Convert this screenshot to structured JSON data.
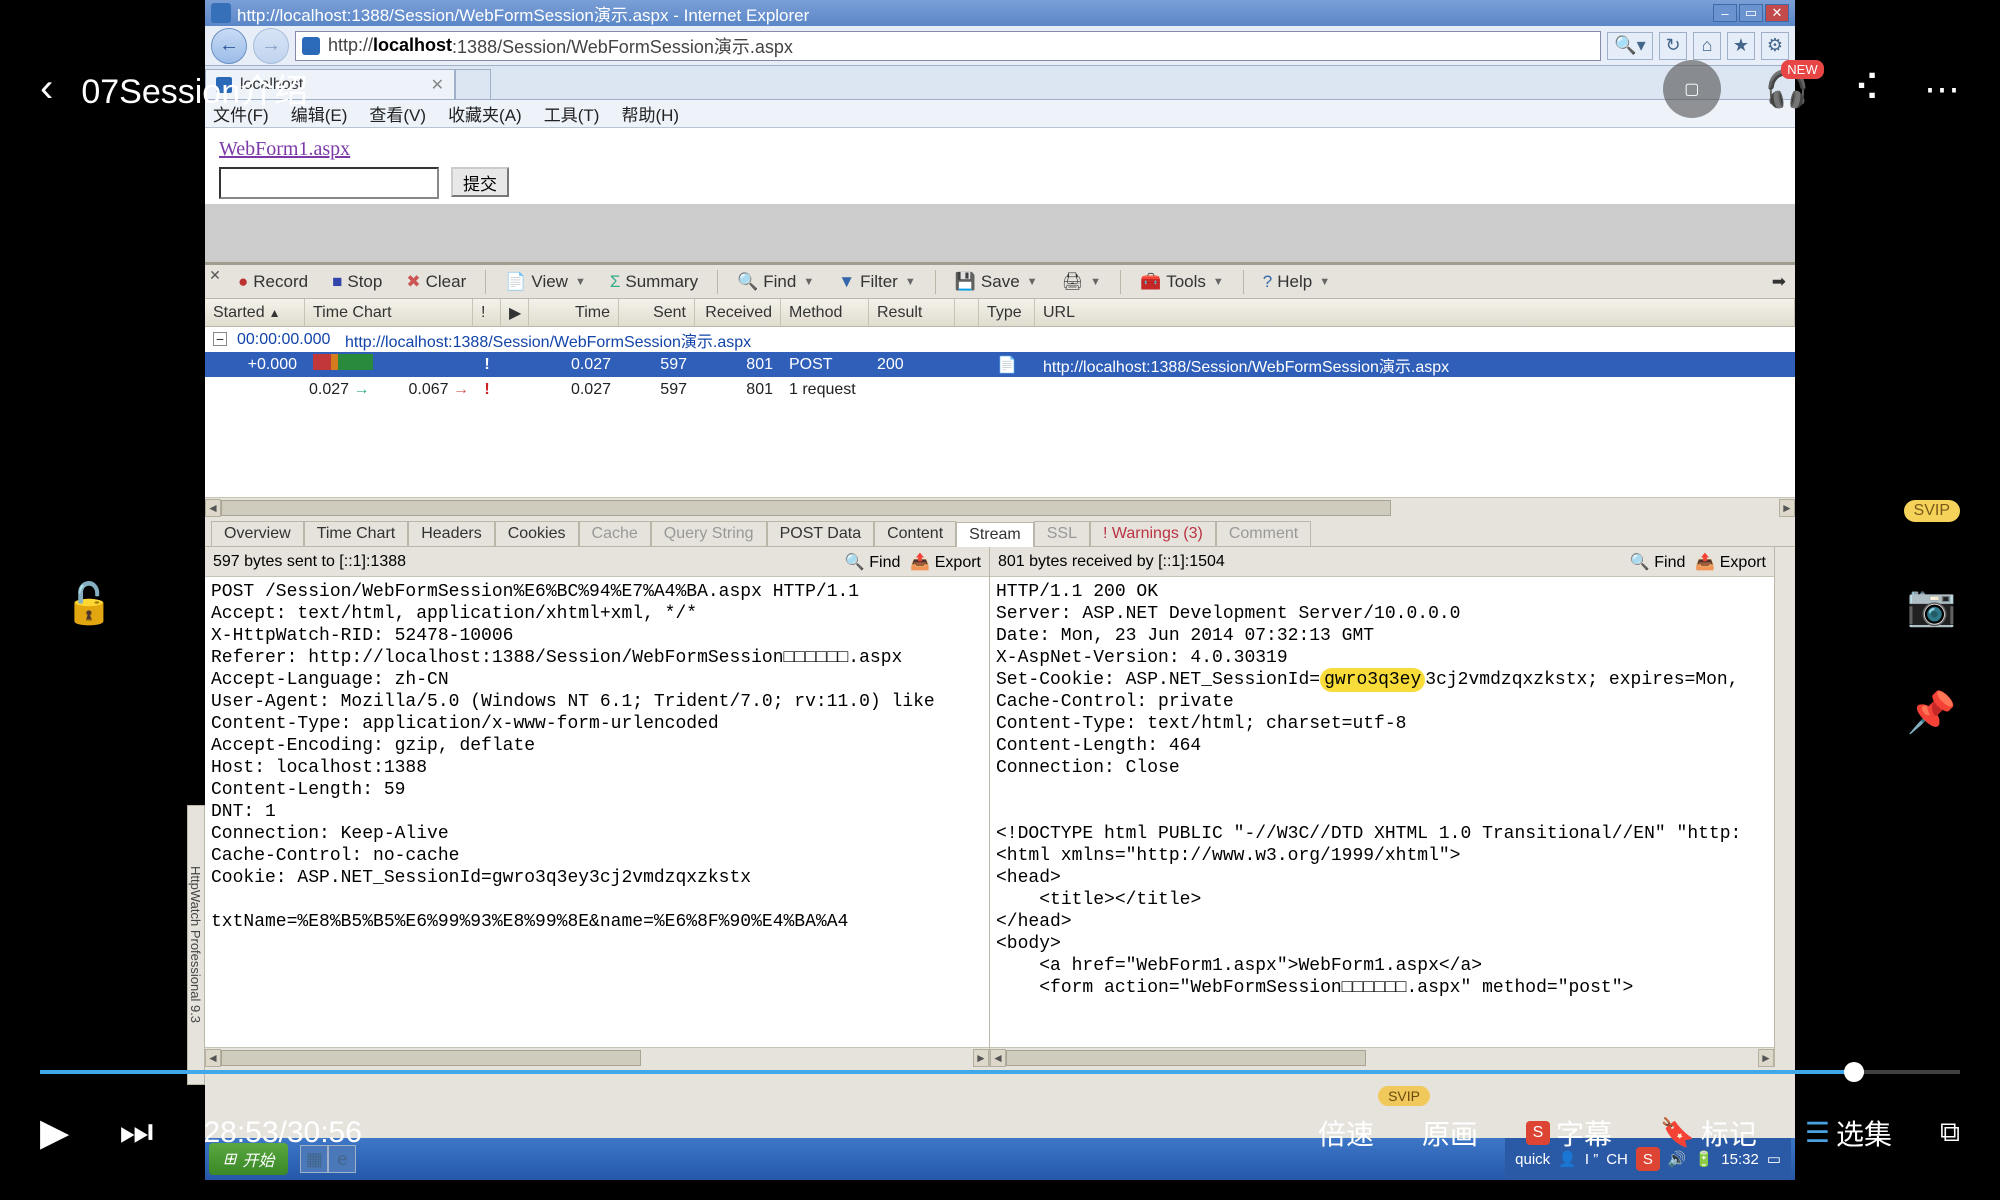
{
  "ie": {
    "title": "http://localhost:1388/Session/WebFormSession演示.aspx - Internet Explorer",
    "url_pre": "http://",
    "url_host": "localhost",
    "url_rest": ":1388/Session/WebFormSession演示.aspx",
    "tab": "localhost",
    "menus": [
      "文件(F)",
      "编辑(E)",
      "查看(V)",
      "收藏夹(A)",
      "工具(T)",
      "帮助(H)"
    ]
  },
  "page": {
    "link": "WebForm1.aspx",
    "submit": "提交"
  },
  "hw": {
    "toolbar": {
      "record": "Record",
      "stop": "Stop",
      "clear": "Clear",
      "view": "View",
      "summary": "Summary",
      "find": "Find",
      "filter": "Filter",
      "save": "Save",
      "tools": "Tools",
      "help": "Help"
    },
    "cols": {
      "started": "Started",
      "timechart": "Time Chart",
      "time": "Time",
      "sent": "Sent",
      "received": "Received",
      "method": "Method",
      "result": "Result",
      "type": "Type",
      "url": "URL"
    },
    "rows": {
      "page": {
        "started": "00:00:00.000",
        "url": "http://localhost:1388/Session/WebFormSession演示.aspx"
      },
      "sel": {
        "started": "+0.000",
        "time": "0.027",
        "sent": "597",
        "recv": "801",
        "method": "POST",
        "result": "200",
        "url": "http://localhost:1388/Session/WebFormSession演示.aspx"
      },
      "sum": {
        "t1": "0.027",
        "t2": "0.067",
        "time": "0.027",
        "sent": "597",
        "recv": "801",
        "method": "1 request"
      }
    },
    "dtabs": [
      "Overview",
      "Time Chart",
      "Headers",
      "Cookies",
      "Cache",
      "Query String",
      "POST Data",
      "Content",
      "Stream",
      "SSL",
      "! Warnings  (3)",
      "Comment"
    ],
    "dtabs_disabled": [
      4,
      5,
      9,
      11
    ],
    "dtabs_active": 8,
    "dtabs_warn": 10,
    "left": {
      "status": "597 bytes sent to [::1]:1388",
      "find": "Find",
      "export": "Export",
      "body": "POST /Session/WebFormSession%E6%BC%94%E7%A4%BA.aspx HTTP/1.1\nAccept: text/html, application/xhtml+xml, */*\nX-HttpWatch-RID: 52478-10006\nReferer: http://localhost:1388/Session/WebFormSession□□□□□□.aspx\nAccept-Language: zh-CN\nUser-Agent: Mozilla/5.0 (Windows NT 6.1; Trident/7.0; rv:11.0) like\nContent-Type: application/x-www-form-urlencoded\nAccept-Encoding: gzip, deflate\nHost: localhost:1388\nContent-Length: 59\nDNT: 1\nConnection: Keep-Alive\nCache-Control: no-cache\nCookie: ASP.NET_SessionId=gwro3q3ey3cj2vmdzqxzkstx\n\ntxtName=%E8%B5%B5%E6%99%93%E8%99%8E&name=%E6%8F%90%E4%BA%A4"
    },
    "right": {
      "status": "801 bytes received by [::1]:1504",
      "body1": "HTTP/1.1 200 OK\nServer: ASP.NET Development Server/10.0.0.0\nDate: Mon, 23 Jun 2014 07:32:13 GMT\nX-AspNet-Version: 4.0.30319\nSet-Cookie: ASP.NET_SessionId=",
      "body_hl": "gwro3q3ey",
      "body2": "3cj2vmdzqxzkstx; expires=Mon,\nCache-Control: private\nContent-Type: text/html; charset=utf-8\nContent-Length: 464\nConnection: Close\n\n\n<!DOCTYPE html PUBLIC \"-//W3C//DTD XHTML 1.0 Transitional//EN\" \"http:\n<html xmlns=\"http://www.w3.org/1999/xhtml\">\n<head>\n    <title></title>\n</head>\n<body>\n    <a href=\"WebForm1.aspx\">WebForm1.aspx</a>\n    <form action=\"WebFormSession□□□□□□.aspx\" method=\"post\">"
    },
    "sidetab": "HttpWatch Professional 9.3"
  },
  "taskbar": {
    "start": "开始",
    "tray": {
      "quick": "quick",
      "ch": "CH",
      "time": "15:32"
    }
  },
  "player": {
    "title": "07Session介绍",
    "time": "28:53/30:56",
    "right": [
      "倍速",
      "原画",
      "字幕",
      "标记",
      "选集"
    ],
    "svip": "SVIP",
    "new": "NEW"
  }
}
